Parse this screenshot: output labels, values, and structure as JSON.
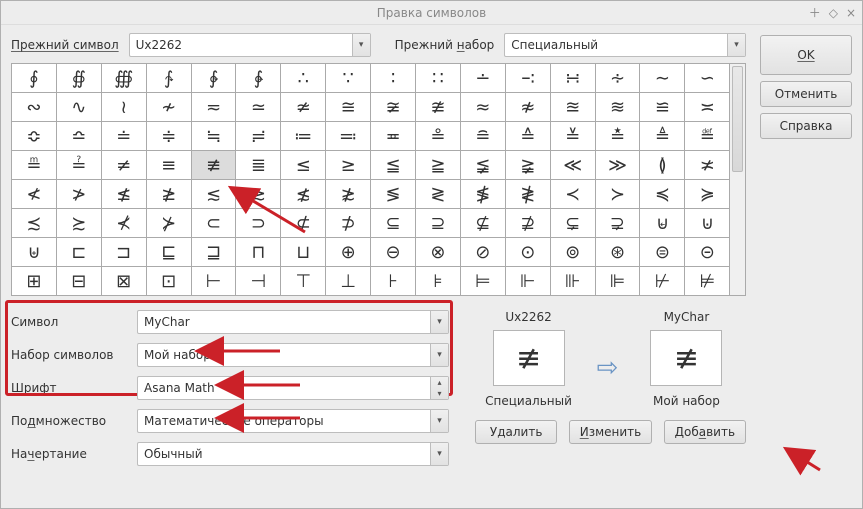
{
  "title": "Правка символов",
  "toprow": {
    "prev_symbol_label": "Прежний символ",
    "prev_symbol_value": "Ux2262",
    "prev_set_label": "Прежний набор",
    "prev_set_value": "Специальный"
  },
  "buttons": {
    "ok": "OK",
    "cancel": "Отменить",
    "help": "Справка",
    "delete": "Удалить",
    "change": "Изменить",
    "add": "Добавить"
  },
  "grid": {
    "rows": [
      [
        "∮",
        "∯",
        "∰",
        "∱",
        "∲",
        "∳",
        "∴",
        "∵",
        "∶",
        "∷",
        "∸",
        "∹",
        "∺",
        "∻",
        "∼",
        "∽"
      ],
      [
        "∾",
        "∿",
        "≀",
        "≁",
        "≂",
        "≃",
        "≄",
        "≅",
        "≆",
        "≇",
        "≈",
        "≉",
        "≊",
        "≋",
        "≌",
        "≍"
      ],
      [
        "≎",
        "≏",
        "≐",
        "≑",
        "≒",
        "≓",
        "≔",
        "≕",
        "≖",
        "≗",
        "≘",
        "≙",
        "≚",
        "≛",
        "≜",
        "≝"
      ],
      [
        "≞",
        "≟",
        "≠",
        "≡",
        "≢",
        "≣",
        "≤",
        "≥",
        "≦",
        "≧",
        "≨",
        "≩",
        "≪",
        "≫",
        "≬",
        "≭"
      ],
      [
        "≮",
        "≯",
        "≰",
        "≱",
        "≲",
        "≳",
        "≴",
        "≵",
        "≶",
        "≷",
        "≸",
        "≹",
        "≺",
        "≻",
        "≼",
        "≽"
      ],
      [
        "≾",
        "≿",
        "⊀",
        "⊁",
        "⊂",
        "⊃",
        "⊄",
        "⊅",
        "⊆",
        "⊇",
        "⊈",
        "⊉",
        "⊊",
        "⊋",
        "⊌",
        "⊍"
      ],
      [
        "⊎",
        "⊏",
        "⊐",
        "⊑",
        "⊒",
        "⊓",
        "⊔",
        "⊕",
        "⊖",
        "⊗",
        "⊘",
        "⊙",
        "⊚",
        "⊛",
        "⊜",
        "⊝"
      ],
      [
        "⊞",
        "⊟",
        "⊠",
        "⊡",
        "⊢",
        "⊣",
        "⊤",
        "⊥",
        "⊦",
        "⊧",
        "⊨",
        "⊩",
        "⊪",
        "⊫",
        "⊬",
        "⊭"
      ]
    ],
    "selected": {
      "row": 3,
      "col": 4
    }
  },
  "form": {
    "symbol_label": "Символ",
    "symbol_value": "MyChar",
    "set_label": "Набор символов",
    "set_value": "Мой набор",
    "font_label": "Шрифт",
    "font_value": "Asana Math",
    "subset_label": "Подмножество",
    "subset_value": "Математические операторы",
    "style_label": "Начертание",
    "style_value": "Обычный"
  },
  "preview": {
    "left_name": "Ux2262",
    "left_glyph": "≢",
    "left_set": "Специальный",
    "right_name": "MyChar",
    "right_glyph": "≢",
    "right_set": "Мой набор"
  }
}
